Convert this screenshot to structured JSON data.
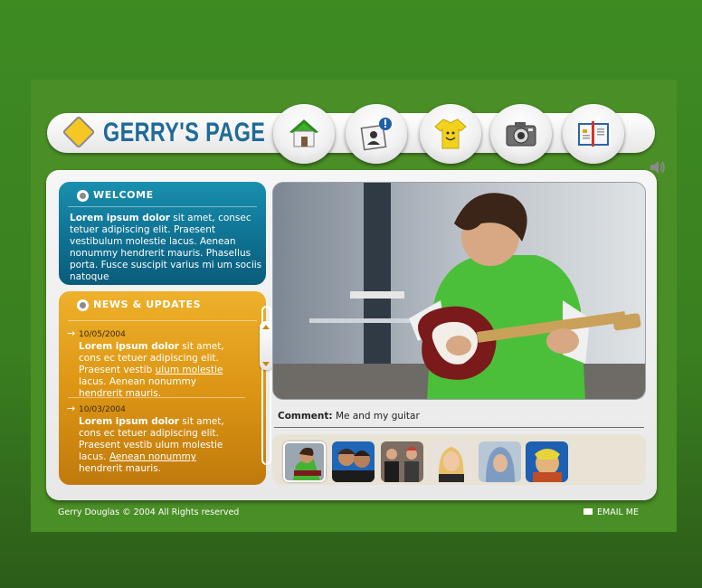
{
  "header": {
    "logo_text": "GERRY'S PAGE",
    "nav_icons": [
      "home-icon",
      "profile-icon",
      "tshirt-icon",
      "camera-icon",
      "guestbook-icon"
    ],
    "sound_icon": "speaker-icon"
  },
  "welcome": {
    "title": "WELCOME",
    "lead": "Lorem ipsum dolor",
    "text": " sit amet, consec tetuer adipiscing elit. Praesent vestibulum molestie lacus. Aenean nonummy hendrerit mauris. Phasellus porta. Fusce suscipit varius mi um sociis natoque"
  },
  "news": {
    "title": "NEWS & UPDATES",
    "items": [
      {
        "date": "10/05/2004",
        "lead": "Lorem ipsum dolor",
        "text1": " sit amet, cons ec tetuer adipiscing elit. Praesent vestib ",
        "link": "ulum molestie",
        "text2": " lacus. Aenean nonummy hendrerit mauris."
      },
      {
        "date": "10/03/2004",
        "lead": "Lorem ipsum dolor",
        "text1": " sit amet, cons ec tetuer adipiscing elit. Praesent vestib ulum molestie lacus. ",
        "link": "Aenean nonummy",
        "text2": " hendrerit mauris."
      }
    ]
  },
  "photo": {
    "caption_label": "Comment:",
    "caption_text": " Me and my guitar"
  },
  "thumbnails": [
    "thumb-guitar",
    "thumb-boys",
    "thumb-friends",
    "thumb-blonde",
    "thumb-hood",
    "thumb-child"
  ],
  "footer": {
    "copyright": "Gerry Douglas  © 2004  All Rights reserved",
    "email": "EMAIL ME"
  },
  "colors": {
    "background": "#3e8b22",
    "welcome_box": "#0e6f90",
    "news_box": "#dd9614",
    "logo_text": "#1f6a98"
  }
}
